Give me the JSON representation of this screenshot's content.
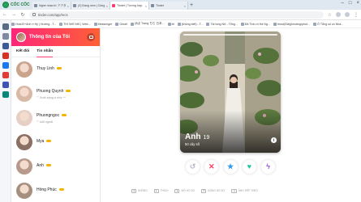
{
  "browser": {
    "brand": "CỐC CỐC",
    "tabs": [
      {
        "title": "Nghe nhạc từ アアタ..."
      },
      {
        "title": "(2) Đang xem | Cống sức đ..."
      },
      {
        "title": "Tinder | Tương hợp. Trò chuyện.",
        "active": true
      },
      {
        "title": "Tinder"
      }
    ],
    "url": "tinder.com/app/recs",
    "bookmarks": [
      "Hoai Đ+Anh ≡ Hy | Hướng - T...",
      "THI NHÌ NHÍ | Web...",
      "Messenger",
      "Gmail",
      "ほぼ Trang ちぢ 日本...",
      "ttt",
      "(không biết) - T...",
      "Tài tung Nữ - Tổng...",
      "Đã Tình ơi Hà Ng...",
      "tmod|Giấy|khoảng/phút...",
      "Ở Tổng số có Nhà..."
    ]
  },
  "sidebar": {
    "title": "Thông tin của Tôi",
    "tabs": [
      {
        "label": "Kết đôi"
      },
      {
        "label": "Tin nhắn"
      }
    ],
    "conversations": [
      {
        "name": "Thuy Linh",
        "message": "",
        "avatar": "#c9a38b"
      },
      {
        "name": "Phuong Quynh",
        "message": "\"\" Xuất sáng a nha ^^",
        "avatar": "#d9b9a6"
      },
      {
        "name": "Phuongngoc",
        "message": "\"\" tuổi ngoài",
        "avatar": "#e6cfc4"
      },
      {
        "name": "Mya",
        "message": "",
        "avatar": "#8a6f62"
      },
      {
        "name": "Anh",
        "message": "",
        "avatar": "#b89a8d"
      },
      {
        "name": "Hồng Phúc",
        "message": "",
        "avatar": "#a58f7f"
      }
    ]
  },
  "card": {
    "name": "Anh",
    "age": "19",
    "distance": "50 cây số"
  },
  "actions": [
    {
      "icon": "rewind-icon",
      "glyph": "↺",
      "color": "#b4b9c4"
    },
    {
      "icon": "nope-icon",
      "glyph": "✕",
      "color": "#fd3c5d"
    },
    {
      "icon": "super-like-icon",
      "glyph": "★",
      "color": "#2e9bf2"
    },
    {
      "icon": "like-icon",
      "glyph": "♥",
      "color": "#19c9a3"
    },
    {
      "icon": "boost-icon",
      "glyph": "ϟ",
      "color": "#9a4ff0"
    }
  ],
  "shortcuts": [
    {
      "key": "◂",
      "label": "KHÔNG"
    },
    {
      "key": "▸",
      "label": "THÍCH"
    },
    {
      "key": "▴",
      "label": "MỞ HỒ SƠ"
    },
    {
      "key": "▾",
      "label": "ĐÓNG HỒ SƠ"
    },
    {
      "key": "⇥",
      "label": "ẢNH TIẾP THEO"
    }
  ]
}
